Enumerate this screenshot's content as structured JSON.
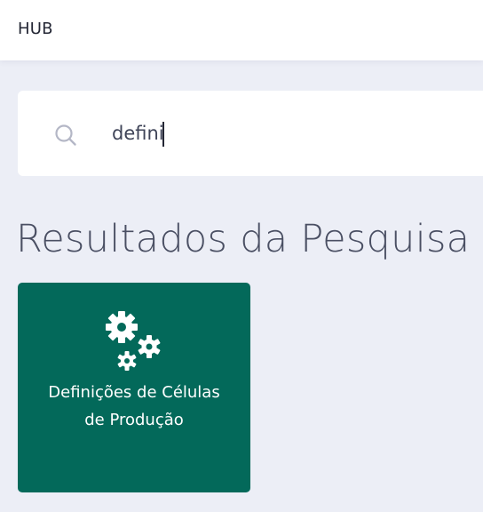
{
  "header": {
    "title": "HUB"
  },
  "search": {
    "value": "defini",
    "icon": "search-icon"
  },
  "results": {
    "heading": "Resultados da Pesquisa",
    "items": [
      {
        "label": "Definições de Células de Produção",
        "icon": "gears-icon",
        "color": "#03695a"
      }
    ]
  },
  "colors": {
    "background": "#eceef6",
    "tile": "#03695a",
    "text": "#3f4458"
  }
}
